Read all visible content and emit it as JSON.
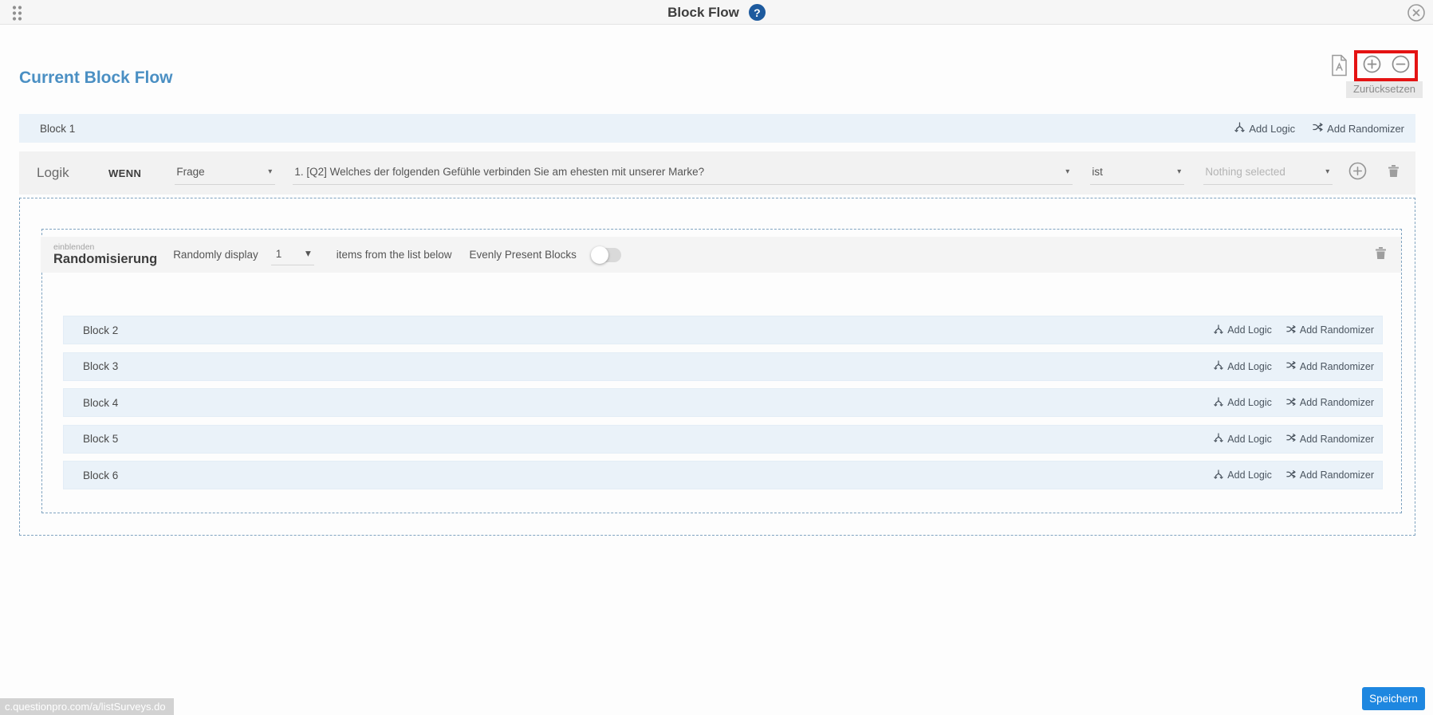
{
  "window": {
    "title": "Block Flow"
  },
  "page": {
    "heading": "Current Block Flow"
  },
  "toolbar": {
    "reset_tooltip": "Zurücksetzen",
    "highlight_color": "#e41313"
  },
  "actions": {
    "add_logic": "Add Logic",
    "add_randomizer": "Add Randomizer"
  },
  "block1": {
    "label": "Block 1"
  },
  "logic": {
    "label": "Logik",
    "condition_keyword": "WENN",
    "type_select_value": "Frage",
    "question_select_value": "1. [Q2]  Welches der folgenden Gefühle verbinden Sie am ehesten mit unserer Marke?",
    "operator_select_value": "ist",
    "value_select_placeholder": "Nothing selected"
  },
  "randomizer": {
    "overline": "einblenden",
    "title": "Randomisierung",
    "randomly_display_label": "Randomly display",
    "count_value": "1",
    "items_label": "items from the list below",
    "evenly_label": "Evenly Present Blocks",
    "evenly_toggle_state": "off",
    "blocks": [
      {
        "label": "Block 2"
      },
      {
        "label": "Block 3"
      },
      {
        "label": "Block 4"
      },
      {
        "label": "Block 5"
      },
      {
        "label": "Block 6"
      }
    ]
  },
  "footer": {
    "save_label": "Speichern",
    "status_url": "c.questionpro.com/a/listSurveys.do"
  },
  "colors": {
    "accent_blue": "#4a8fc3",
    "block_row_bg": "#eaf2f9",
    "dashed_border": "#7fa3c0",
    "save_button": "#1e87e0",
    "help_badge": "#1d5a9e"
  }
}
